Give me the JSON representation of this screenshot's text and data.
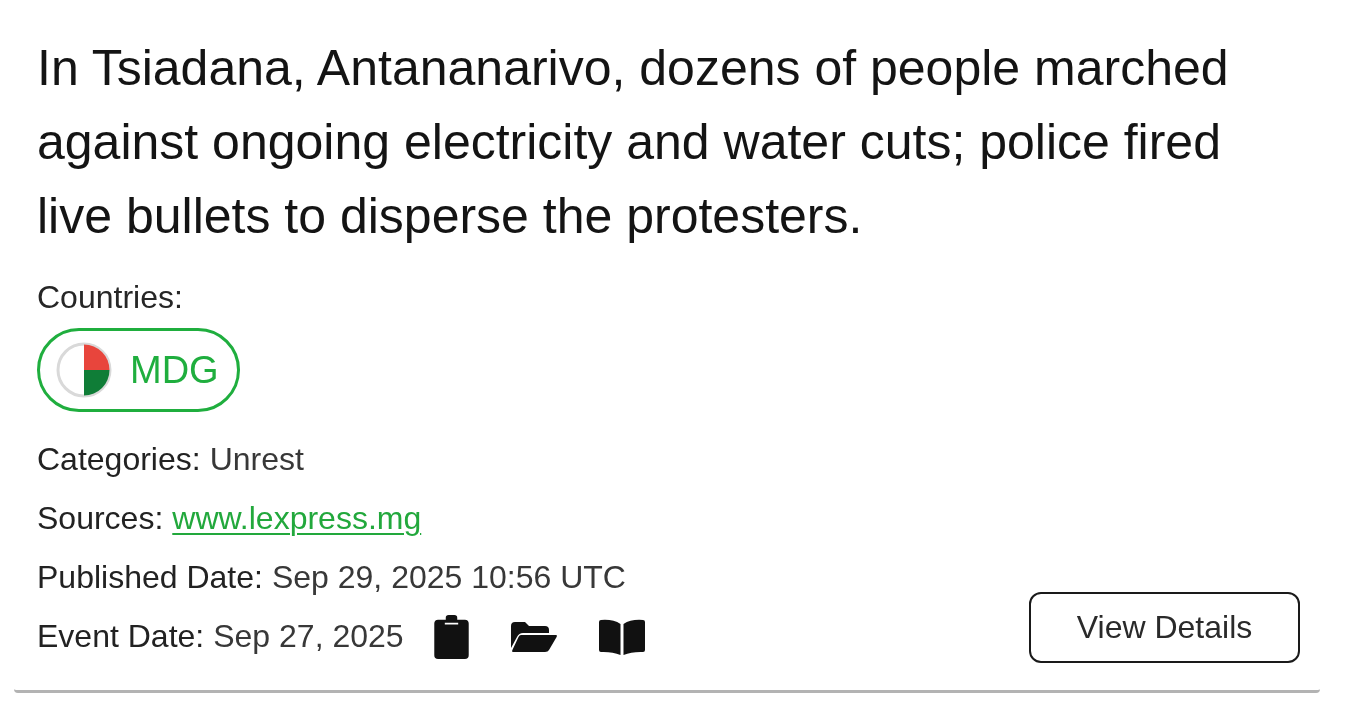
{
  "summary": "In Tsiadana, Antananarivo, dozens of people marched against ongoing electricity and water cuts; police fired live bullets to disperse the protesters.",
  "countries": {
    "label": "Countries:",
    "items": [
      {
        "code": "MDG"
      }
    ]
  },
  "fields": [
    {
      "kind": "text",
      "label": "Categories:",
      "value": "Unrest"
    },
    {
      "kind": "link",
      "label": "Sources:",
      "value": "www.lexpress.mg"
    },
    {
      "kind": "text",
      "label": "Published Date:",
      "value": "Sep 29, 2025 10:56 UTC"
    },
    {
      "kind": "text",
      "label": "Event Date:",
      "value": "Sep 27, 2025"
    }
  ],
  "view_details_button": "View Details"
}
